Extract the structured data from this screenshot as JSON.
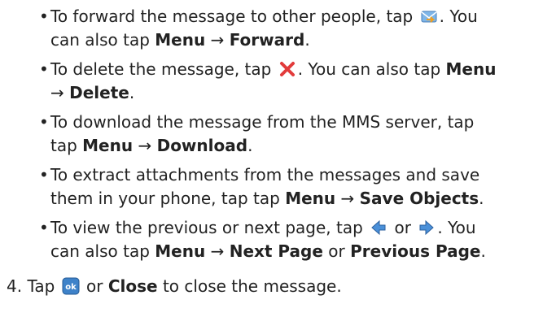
{
  "bullets": [
    {
      "a": "To forward the message to other people, tap",
      "b": ". You",
      "c": "can also tap",
      "menu": "Menu",
      "arrow": "→",
      "target": "Forward",
      "end": ".",
      "icon": "forward-icon"
    },
    {
      "a": "To delete the message, tap",
      "b": ". You can also tap",
      "menu": "Menu",
      "arrow": "→",
      "target": "Delete",
      "end": ".",
      "icon": "delete-icon"
    },
    {
      "a": "To download the message from the MMS server, tap",
      "c": "tap",
      "menu": "Menu",
      "arrow": "→",
      "target": "Download",
      "end": "."
    },
    {
      "a": "To extract attachments from the messages and save",
      "c": "them in your phone, tap tap",
      "menu": "Menu",
      "arrow": "→",
      "target": "Save Objects",
      "end": "."
    },
    {
      "a": "To view the previous or next page, tap",
      "or": "or",
      "b": ". You",
      "c": "can also tap",
      "menu": "Menu",
      "arrow": "→",
      "target": "Next Page",
      "or2": "or",
      "target2": "Previous Page",
      "end": "."
    }
  ],
  "step": {
    "number": "4.",
    "tap": "Tap",
    "or": "or",
    "close": "Close",
    "rest": "to close the message.",
    "icon": "ok-icon"
  }
}
